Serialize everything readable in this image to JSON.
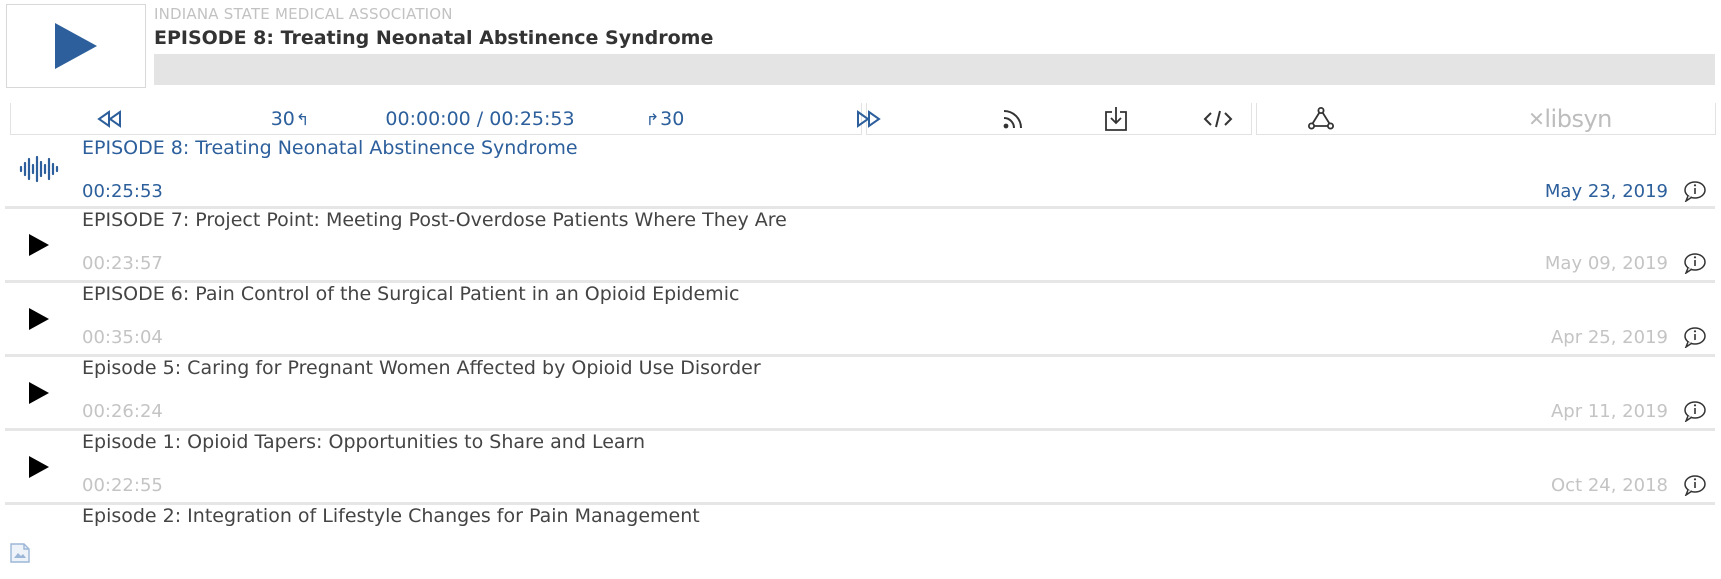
{
  "header": {
    "org_name": "INDIANA STATE MEDICAL ASSOCIATION",
    "episode_title": "EPISODE 8: Treating Neonatal Abstinence Syndrome"
  },
  "controls": {
    "back30_label": "30",
    "forward30_label": "30",
    "time_display": "00:00:00 / 00:25:53",
    "brand": "libsyn"
  },
  "colors": {
    "accent": "#2c5f9b",
    "progress_bg": "#e4e4e4",
    "muted": "#c4c4c4"
  },
  "episodes": [
    {
      "title": "EPISODE 8: Treating Neonatal Abstinence Syndrome",
      "duration": "00:25:53",
      "date": "May 23, 2019",
      "icon": "waveform-icon"
    },
    {
      "title": "EPISODE 7: Project Point: Meeting Post-Overdose Patients Where They Are",
      "duration": "00:23:57",
      "date": "May 09, 2019",
      "icon": "play-icon"
    },
    {
      "title": "EPISODE 6: Pain Control of the Surgical Patient in an Opioid Epidemic",
      "duration": "00:35:04",
      "date": "Apr 25, 2019",
      "icon": "play-icon"
    },
    {
      "title": "Episode 5: Caring for Pregnant Women Affected by Opioid Use Disorder",
      "duration": "00:26:24",
      "date": "Apr 11, 2019",
      "icon": "play-icon"
    },
    {
      "title": "Episode 1: Opioid Tapers: Opportunities to Share and Learn",
      "duration": "00:22:55",
      "date": "Oct 24, 2018",
      "icon": "play-icon"
    },
    {
      "title": "Episode 2: Integration of Lifestyle Changes for Pain Management",
      "duration": "",
      "date": "",
      "icon": "play-icon"
    }
  ]
}
